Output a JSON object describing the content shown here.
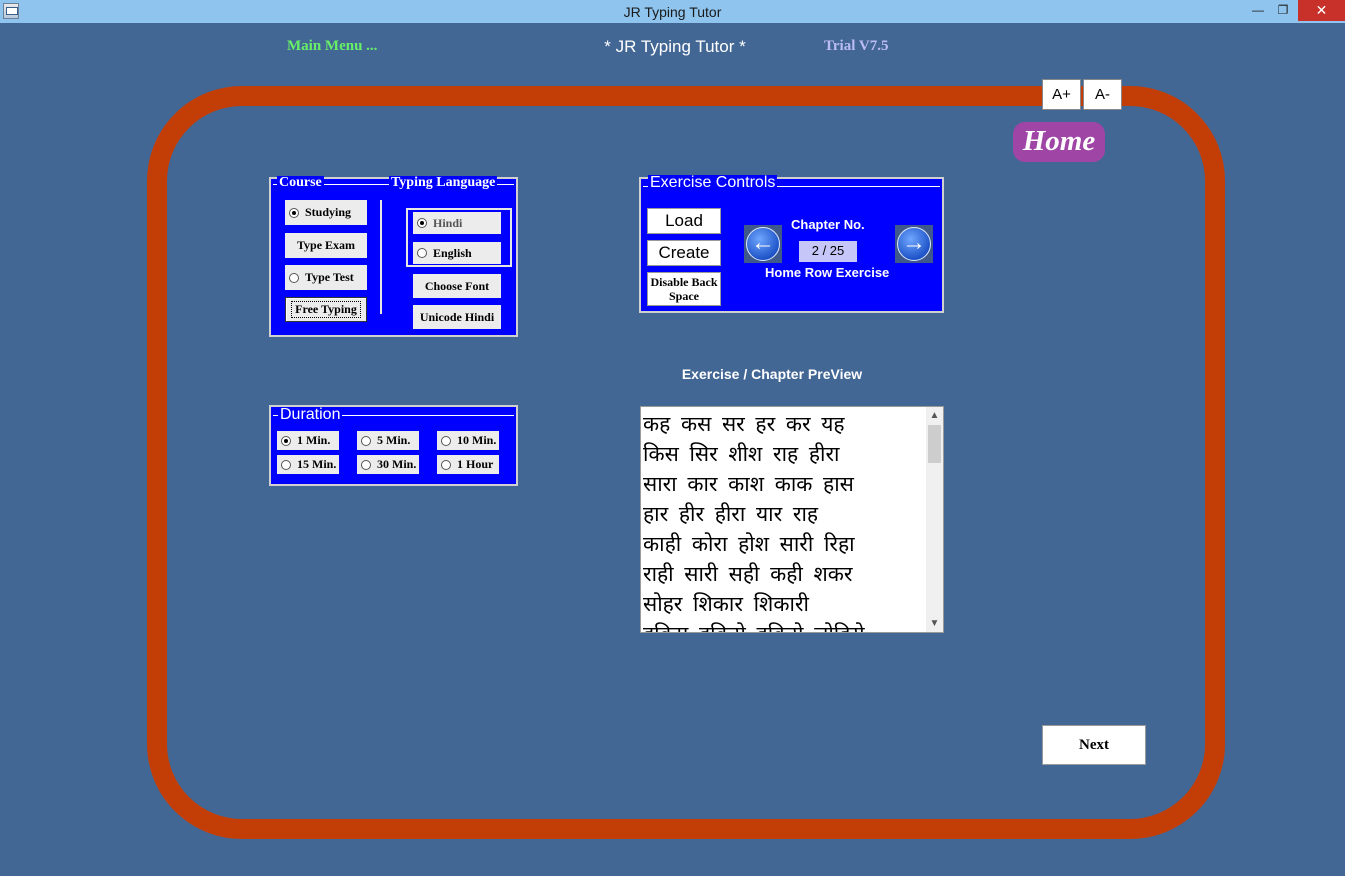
{
  "window": {
    "title": "JR Typing Tutor",
    "minimize": "—",
    "maximize": "❐",
    "close": "✕"
  },
  "header": {
    "main_menu": "Main Menu ...",
    "app_title": "* JR Typing Tutor *",
    "edition": "Trial V7.5"
  },
  "font_controls": {
    "increase": "A+",
    "decrease": "A-"
  },
  "home_label": "Home",
  "course": {
    "legend": "Course",
    "options": [
      "Studying",
      "Type Exam",
      "Type Test",
      "Free Typing"
    ],
    "selected": "Studying"
  },
  "typing_language": {
    "legend": "Typing Language",
    "options": [
      "Hindi",
      "English"
    ],
    "selected": "Hindi",
    "choose_font": "Choose Font",
    "unicode_hindi": "Unicode Hindi"
  },
  "exercise_controls": {
    "legend": "Exercise Controls",
    "load": "Load",
    "create": "Create",
    "disable_backspace": "Disable Back Space",
    "chapter_label": "Chapter No.",
    "chapter_count": "2 / 25",
    "exercise_name": "Home Row Exercise"
  },
  "duration": {
    "legend": "Duration",
    "options": [
      "1 Min.",
      "5 Min.",
      "10 Min.",
      "15 Min.",
      "30 Min.",
      "1 Hour"
    ],
    "selected": "1 Min."
  },
  "preview": {
    "title": "Exercise / Chapter PreView",
    "text": "कह कस सर हर कर यह\nकिस सिर शीश राह हीरा\nसारा कार काश काक हास\nहार हीर हीरा यार राह\nकाही कोरा होश सारी रिहा\nराही सारी सही कही शकर\nसोहर शिकार शिकारी\nहकिम हकिसे हकिसे लोहिसे"
  },
  "next_button": "Next",
  "colors": {
    "background": "#436795",
    "track": "#c33e07",
    "panel": "#0000ff",
    "home_badge": "#9f45a6",
    "titlebar": "#8ec4ee"
  }
}
